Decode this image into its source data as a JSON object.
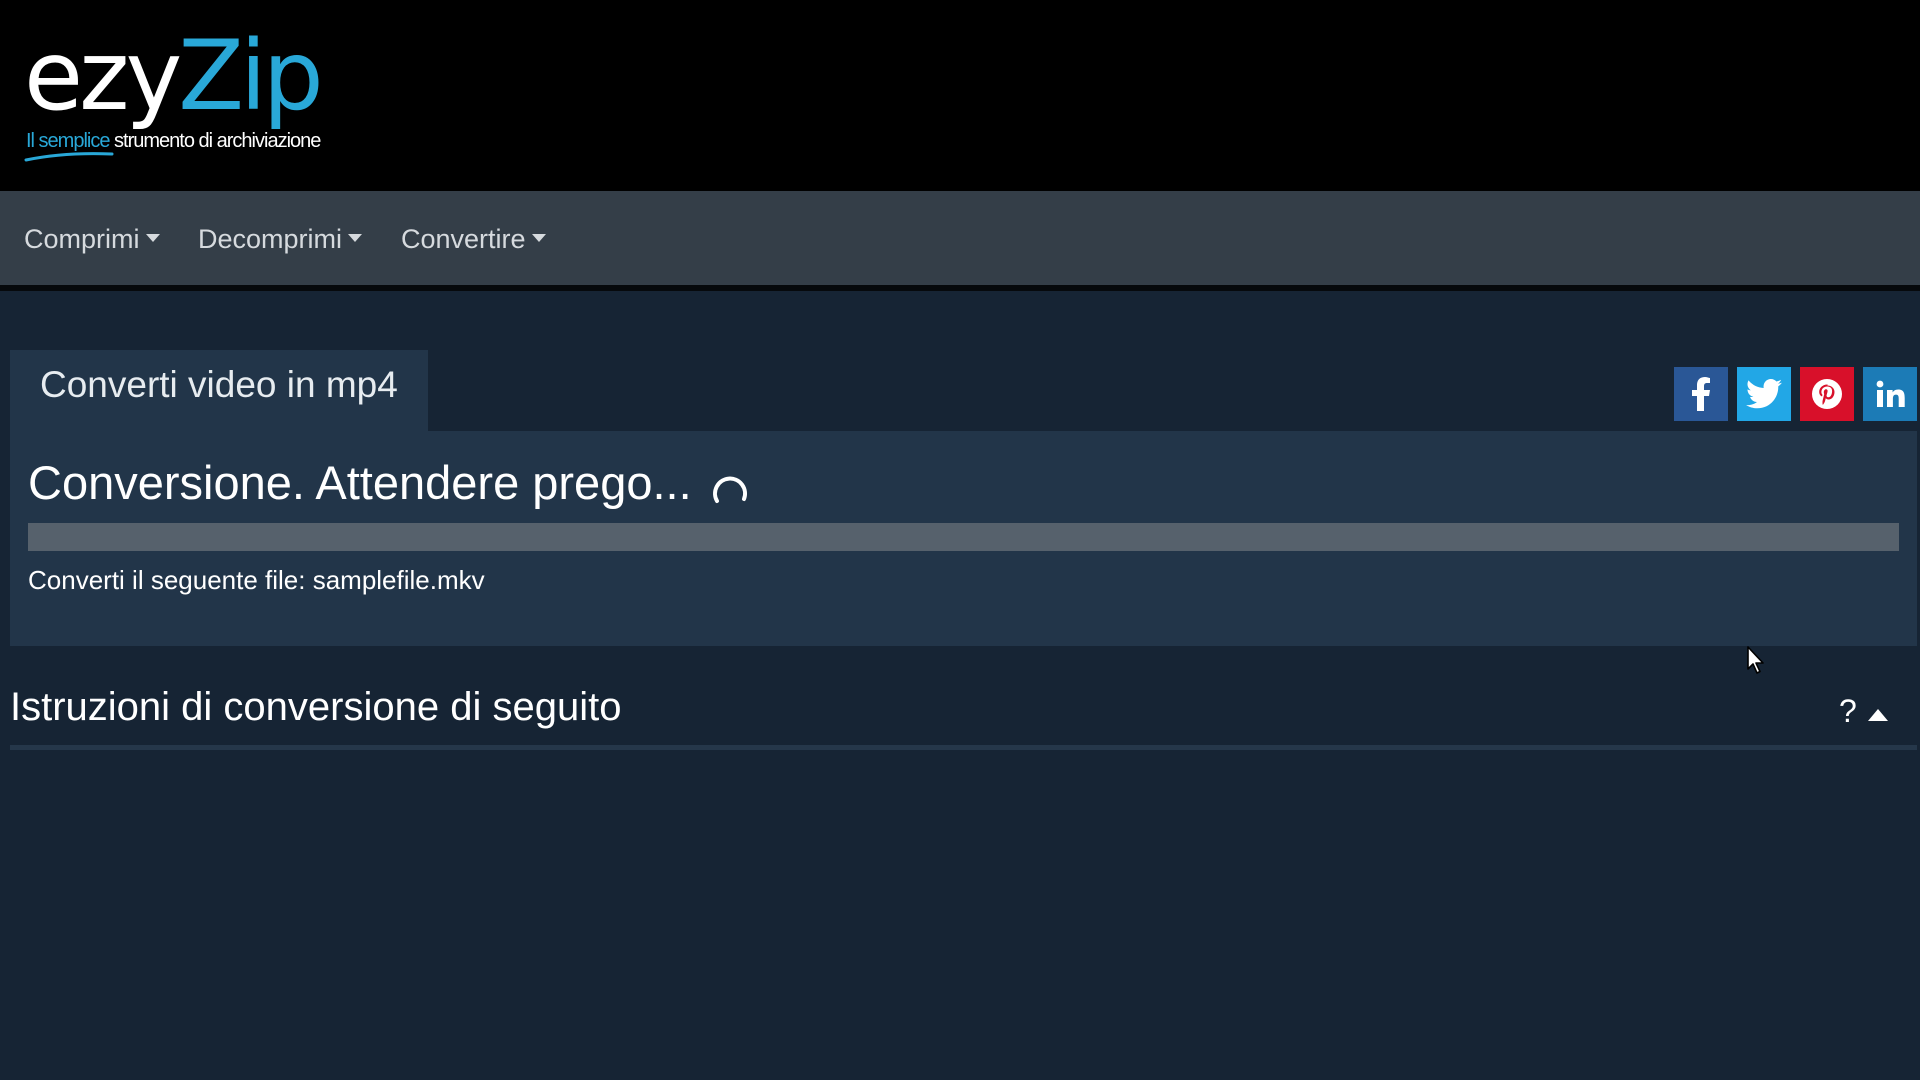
{
  "brand": {
    "name_part1": "ezy",
    "name_part2": "Zip",
    "tagline_highlight": "Il semplice",
    "tagline_rest": "strumento di archiviazione"
  },
  "nav": {
    "items": [
      {
        "label": "Comprimi"
      },
      {
        "label": "Decomprimi"
      },
      {
        "label": "Convertire"
      }
    ]
  },
  "tab": {
    "label": "Converti video in mp4"
  },
  "conversion": {
    "status_title": "Conversione. Attendere prego...",
    "progress_percent": 0,
    "file_line": "Converti il seguente file: samplefile.mkv"
  },
  "share": {
    "icons": [
      "facebook-icon",
      "twitter-icon",
      "pinterest-icon",
      "linkedin-icon"
    ]
  },
  "instructions": {
    "title": "Istruzioni di conversione di seguito",
    "help_label": "?"
  },
  "colors": {
    "accent": "#29a8d8",
    "header_bg": "#000000",
    "nav_bg": "#343e48",
    "page_bg": "#162434",
    "panel_bg": "#223549",
    "facebook": "#2a5796",
    "twitter": "#22a7e6",
    "pinterest": "#d8102a",
    "linkedin": "#1c7bb6"
  }
}
